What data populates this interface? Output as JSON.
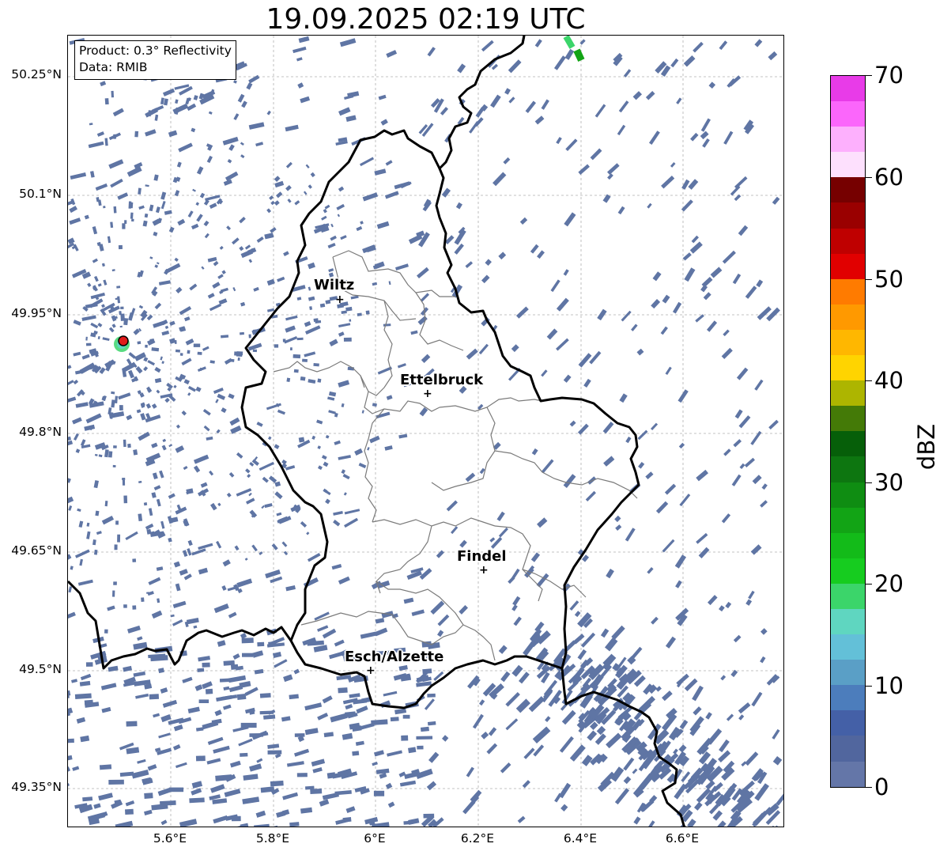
{
  "title": "19.09.2025 02:19 UTC",
  "info_box": {
    "product": "Product: 0.3° Reflectivity",
    "data": "Data: RMIB"
  },
  "lat_labels": [
    "50.25°N",
    "50.1°N",
    "49.95°N",
    "49.8°N",
    "49.65°N",
    "49.5°N",
    "49.35°N"
  ],
  "lon_labels": [
    "5.6°E",
    "5.8°E",
    "6°E",
    "6.2°E",
    "6.4°E",
    "6.6°E"
  ],
  "cities": [
    {
      "name": "Wiltz"
    },
    {
      "name": "Ettelbruck"
    },
    {
      "name": "Findel"
    },
    {
      "name": "Esch/Alzette"
    }
  ],
  "colorbar": {
    "label": "dBZ",
    "ticks": [
      "70",
      "60",
      "50",
      "40",
      "30",
      "20",
      "10",
      "0"
    ],
    "colors": [
      "#e83be8",
      "#fb66fb",
      "#fdb0fd",
      "#fde0fd",
      "#760000",
      "#9a0000",
      "#bf0000",
      "#e10000",
      "#ff7b00",
      "#ff9900",
      "#ffb700",
      "#ffd400",
      "#adb500",
      "#447a07",
      "#065f09",
      "#0d7610",
      "#0f8d12",
      "#12a415",
      "#13bb19",
      "#16cc1f",
      "#3bd56a",
      "#5fd6c0",
      "#63c0d8",
      "#5a9fc6",
      "#4c7dbc",
      "#4460a7",
      "#51669e",
      "#6476a8"
    ]
  },
  "radar_site_color": "#e01b1b",
  "echo_color": "#5f75a4"
}
